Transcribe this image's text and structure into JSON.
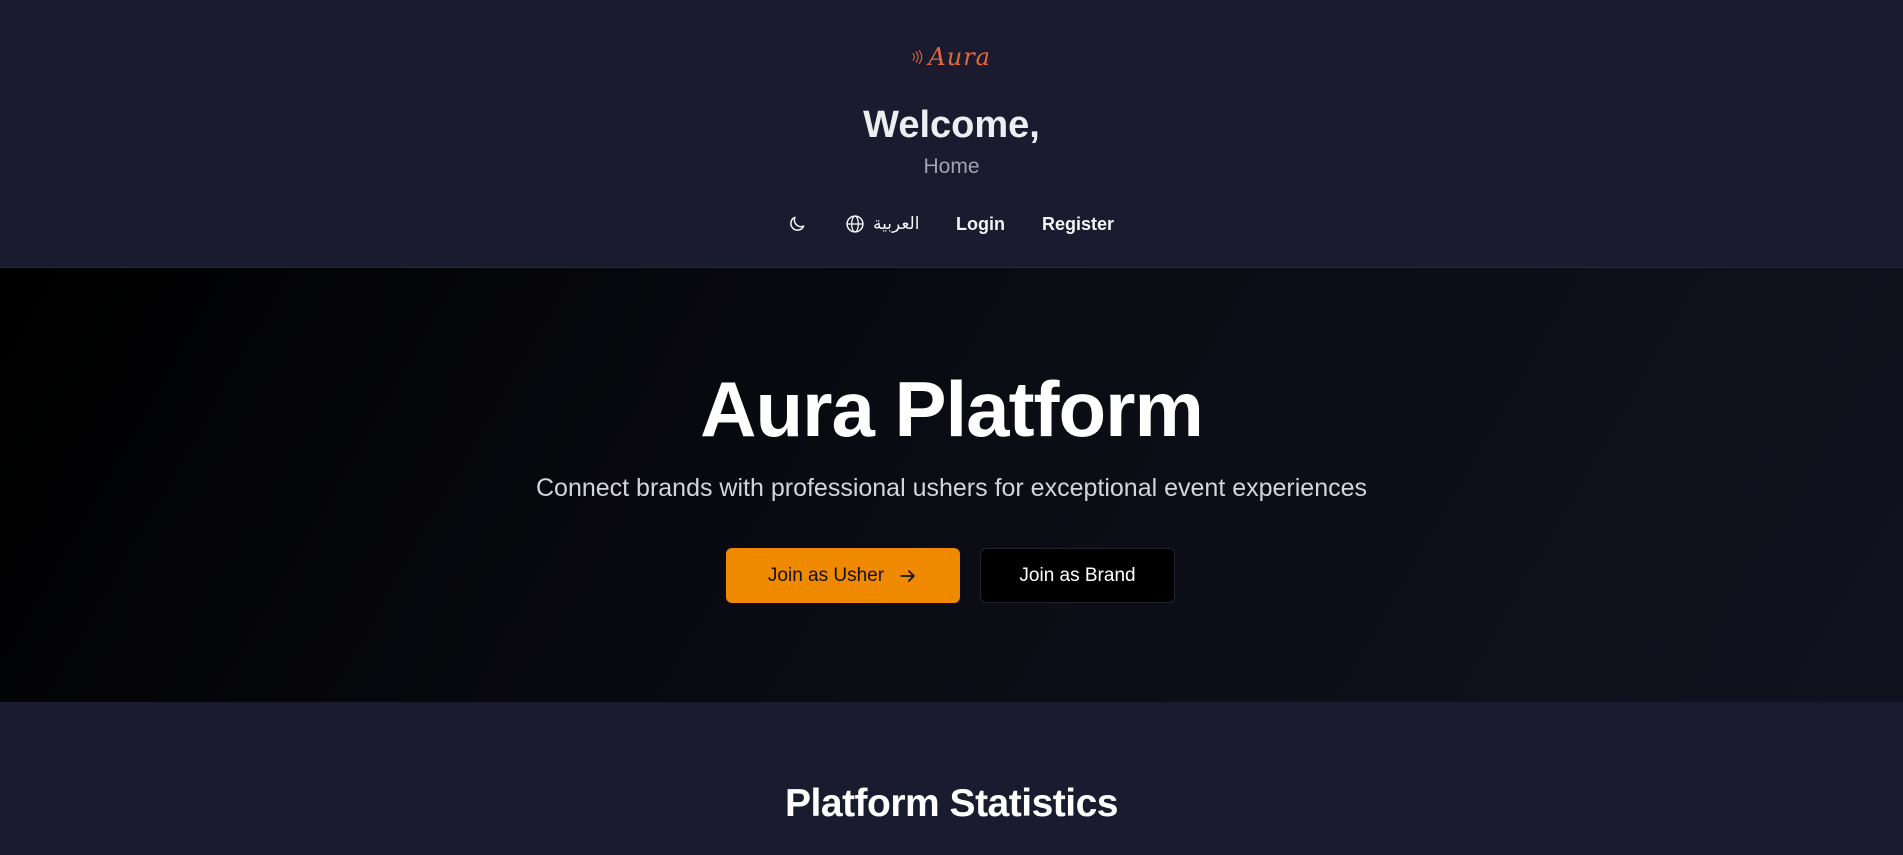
{
  "header": {
    "logo_text": "Aura",
    "welcome": "Welcome,",
    "subtitle": "Home",
    "nav": {
      "theme_icon": "moon-icon",
      "language_icon": "globe-icon",
      "language_label": "العربية",
      "login_label": "Login",
      "register_label": "Register"
    }
  },
  "hero": {
    "title": "Aura Platform",
    "subtitle": "Connect brands with professional ushers for exceptional event experiences",
    "usher_button": "Join as Usher",
    "usher_button_icon": "arrow-right-icon",
    "brand_button": "Join as Brand"
  },
  "stats": {
    "title": "Platform Statistics"
  },
  "colors": {
    "accent": "#ef8a00",
    "logo": "#e2673a",
    "background": "#1a1b2e",
    "hero_background": "#000000"
  }
}
